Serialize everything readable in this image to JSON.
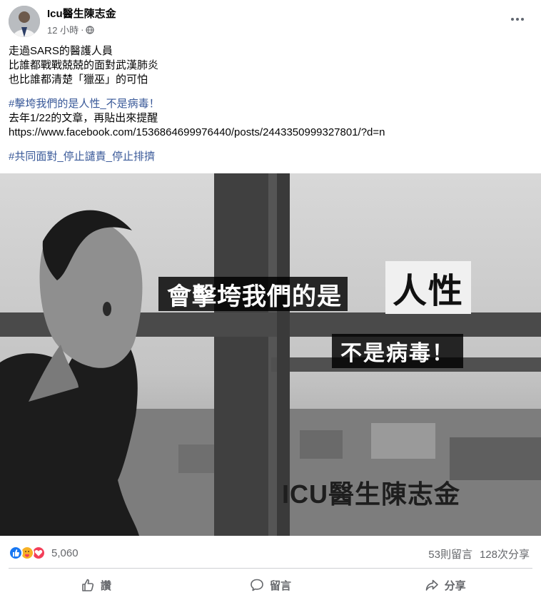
{
  "post": {
    "author": "Icu醫生陳志金",
    "time": "12 小時",
    "separator": "·",
    "privacy_icon": "globe-icon",
    "more_icon": "more-options-icon"
  },
  "content": {
    "line1": "走過SARS的醫護人員",
    "line2": "比誰都戰戰兢兢的面對武漢肺炎",
    "line3": "也比誰都清楚「獵巫」的可怕",
    "hashtag1": "#擊垮我們的是人性_不是病毒！",
    "line4": "去年1/22的文章，再貼出來提醒",
    "link": "https://www.facebook.com/1536864699976440/posts/2443350999327801/?d=n",
    "hashtag2": "#共同面對_停止譴責_停止排擠"
  },
  "image": {
    "caption_part1": "會擊垮我們的是",
    "caption_part2": "人性",
    "caption_line2": "不是病毒！",
    "watermark": "ICU醫生陳志金"
  },
  "engagement": {
    "reaction_count": "5,060",
    "comments": "53則留言",
    "shares": "128次分享",
    "reaction_icons": [
      "like-icon",
      "care-icon",
      "love-icon"
    ]
  },
  "actions": {
    "like": "讚",
    "comment": "留言",
    "share": "分享"
  },
  "colors": {
    "hashtag": "#385898",
    "like": "#1877f2",
    "love": "#f33e58",
    "care": "#f7b125",
    "secondary_text": "#65676b"
  }
}
